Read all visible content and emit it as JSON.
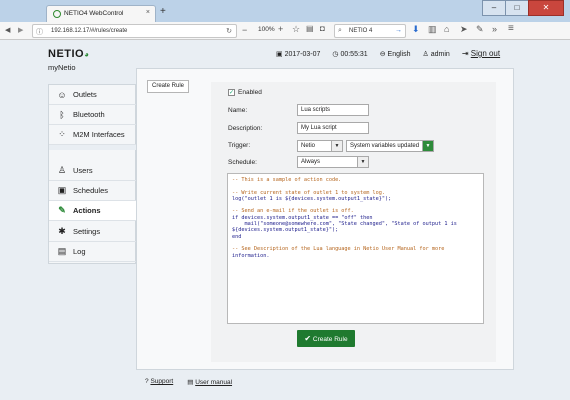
{
  "browser": {
    "tab_title": "NETIO4 WebControl",
    "tab_close": "×",
    "new_tab": "+",
    "url": "192.168.12.17/#/rules/create",
    "zoom": "100%",
    "search_placeholder": "NETIO 4",
    "window_buttons": [
      "–",
      "□",
      "✕"
    ]
  },
  "header": {
    "brand": "NETIO",
    "device_name": "myNetio",
    "date": "2017-03-07",
    "time": "00:55:31",
    "language": "English",
    "user": "admin",
    "sign_out": "Sign out"
  },
  "sidebar": {
    "items": [
      {
        "label": "Outlets",
        "icon": "outlets-icon"
      },
      {
        "label": "Bluetooth",
        "icon": "bluetooth-icon"
      },
      {
        "label": "M2M Interfaces",
        "icon": "m2m-icon"
      },
      {
        "label": "Users",
        "icon": "users-icon"
      },
      {
        "label": "Schedules",
        "icon": "schedules-icon"
      },
      {
        "label": "Actions",
        "icon": "actions-icon"
      },
      {
        "label": "Settings",
        "icon": "settings-icon"
      },
      {
        "label": "Log",
        "icon": "log-icon"
      }
    ],
    "active": "Actions"
  },
  "main": {
    "create_rule_side": "Create Rule",
    "enabled_label": "Enabled",
    "name_label": "Name:",
    "name_value": "Lua scripts",
    "description_label": "Description:",
    "description_value": "My Lua script",
    "trigger_label": "Trigger:",
    "trigger_value": "Netio",
    "trigger_event": "System variables updated",
    "schedule_label": "Schedule:",
    "schedule_value": "Always",
    "code_lines": [
      "-- This is a sample of action code.",
      "",
      "-- Write current state of outlet 1 to system log.",
      "log(\"outlet 1 is ${devices.system.output1_state}\");",
      "",
      "-- Send an e-mail if the outlet is off.",
      "if devices.system.output1_state == \"off\" then",
      "    mail(\"someone@somewhere.com\", \"State changed\", \"State of output 1 is",
      "${devices.system.output1_state}\");",
      "end",
      "",
      "-- See Description of the Lua language in Netio User Manual for more",
      "information."
    ],
    "create_button": "Create Rule"
  },
  "footer": {
    "support": "Support",
    "user_manual": "User manual"
  },
  "colors": {
    "brand_green": "#2e8b3a",
    "button_green": "#1f7a2f"
  }
}
